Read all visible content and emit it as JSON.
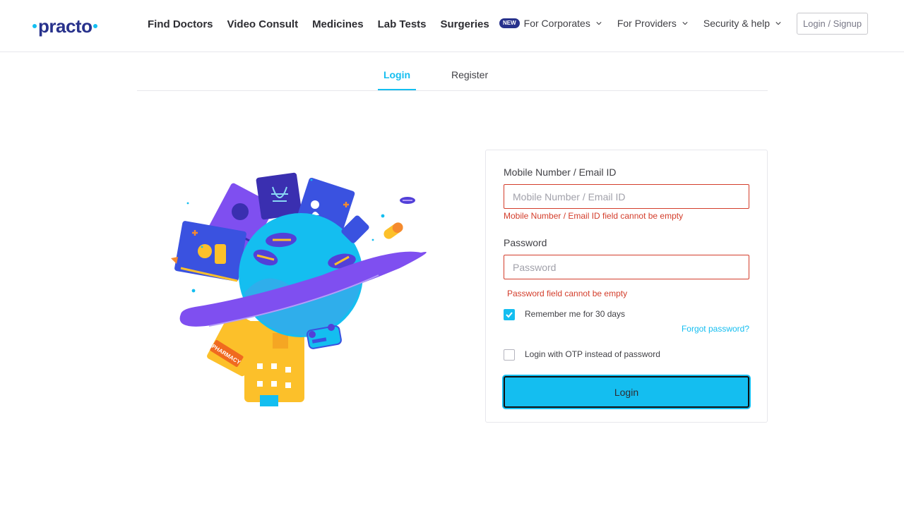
{
  "brand": {
    "name": "practo"
  },
  "nav": {
    "main": [
      "Find Doctors",
      "Video Consult",
      "Medicines",
      "Lab Tests",
      "Surgeries"
    ],
    "new_badge": "NEW",
    "corporates": "For Corporates",
    "providers": "For Providers",
    "security": "Security & help",
    "login_signup": "Login / Signup"
  },
  "tabs": {
    "login": "Login",
    "register": "Register"
  },
  "form": {
    "user_label": "Mobile Number / Email ID",
    "user_placeholder": "Mobile Number / Email ID",
    "user_error": "Mobile Number / Email ID field cannot be empty",
    "password_label": "Password",
    "password_placeholder": "Password",
    "password_error": "Password field cannot be empty",
    "remember_label": "Remember me for 30 days",
    "remember_checked": true,
    "forgot": "Forgot password?",
    "otp_label": "Login with OTP instead of password",
    "otp_checked": false,
    "submit": "Login"
  },
  "illustration": {
    "pharmacy_sign": "PHARMACY"
  },
  "colors": {
    "brand_navy": "#28328c",
    "accent_blue": "#14bef0",
    "error_red": "#d33d2b"
  }
}
